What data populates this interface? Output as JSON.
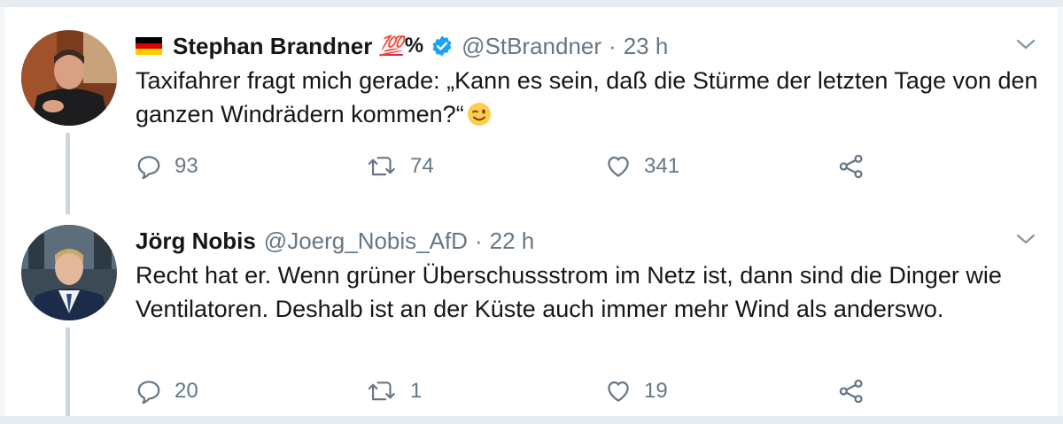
{
  "tweets": [
    {
      "name": "Stephan Brandner",
      "flag": "German flag",
      "name_emoji": "💯",
      "name_suffix": "%",
      "verified": true,
      "handle": "@StBrandner",
      "separator": "·",
      "time": "23 h",
      "text": "Taxifahrer fragt mich gerade: „Kann es sein, daß die Stürme der letzten Tage von den ganzen Windrädern kommen?“",
      "text_emoji": "winking-face",
      "replies": "93",
      "retweets": "74",
      "likes": "341"
    },
    {
      "name": "Jörg Nobis",
      "handle": "@Joerg_Nobis_AfD",
      "separator": "·",
      "time": "22 h",
      "text": "Recht hat er. Wenn grüner Überschussstrom im Netz ist, dann sind die Dinger wie Ventilatoren. Deshalb ist an der Küste auch immer mehr Wind als anderswo.",
      "replies": "20",
      "retweets": "1",
      "likes": "19"
    }
  ],
  "colors": {
    "text": "#14171a",
    "secondary": "#657786",
    "verified": "#1da1f2",
    "thread_line": "#ccd6dd",
    "border": "#e6ecf0"
  }
}
